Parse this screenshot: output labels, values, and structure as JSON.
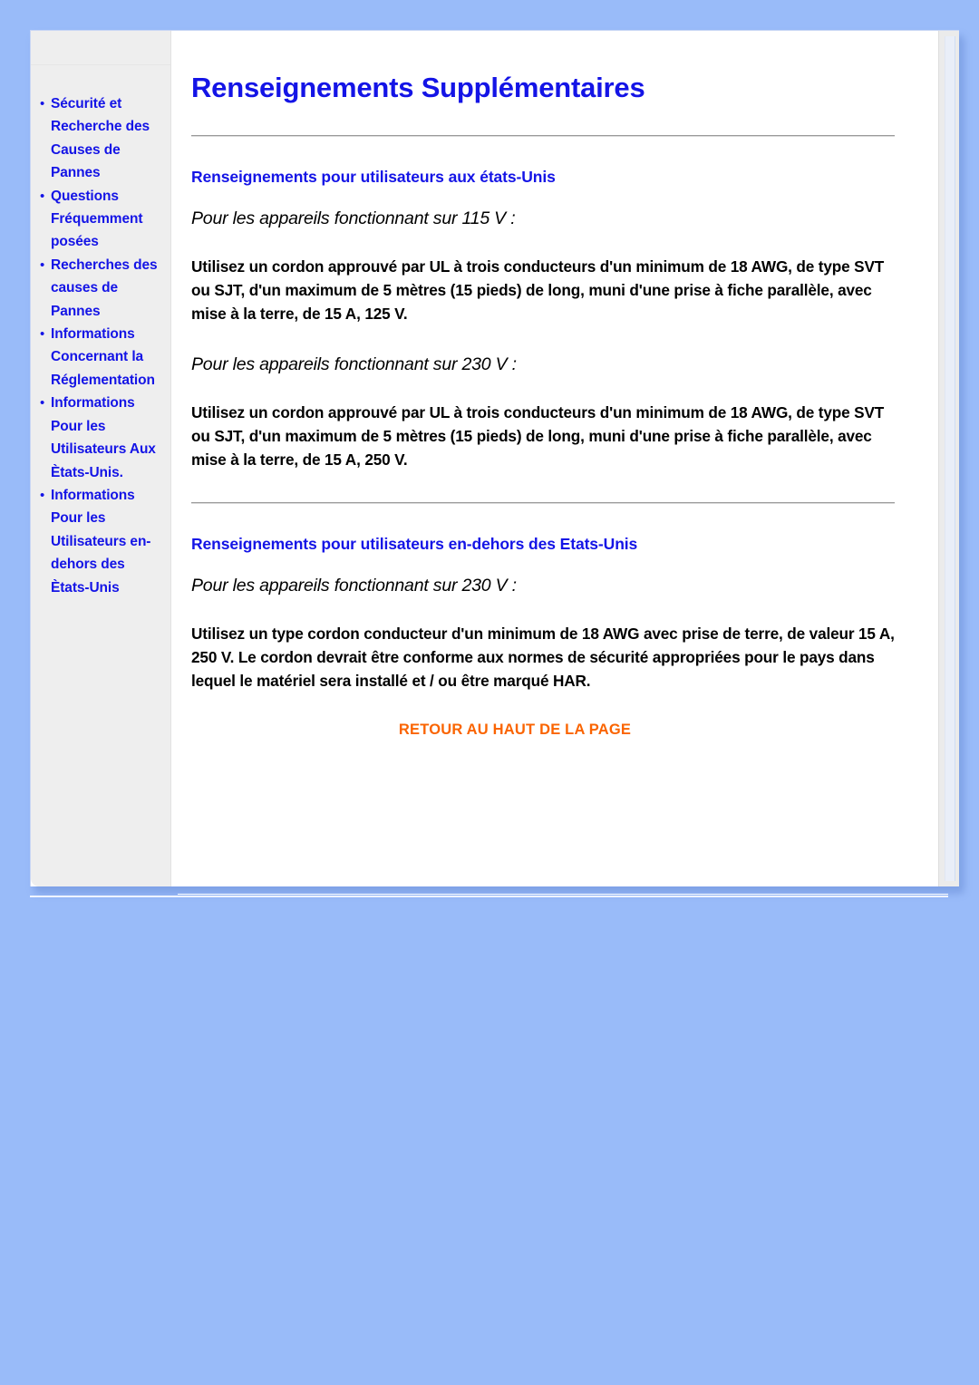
{
  "page": {
    "title": "Renseignements Supplémentaires",
    "background_color": "#99bbf9",
    "link_color": "#1414e6",
    "accent_color": "#fa6400"
  },
  "sidebar": {
    "items": [
      {
        "label": "Sécurité et Recherche des Causes de Pannes"
      },
      {
        "label": "Questions Fréquemment posées"
      },
      {
        "label": "Recherches des causes de Pannes"
      },
      {
        "label": "Informations Concernant la Réglementation"
      },
      {
        "label": "Informations Pour les Utilisateurs Aux Ètats-Unis."
      },
      {
        "label": "Informations Pour les Utilisateurs en-dehors des Ètats-Unis"
      }
    ],
    "bullet_glyph": "•"
  },
  "main": {
    "heading": "Renseignements Supplémentaires",
    "sections": [
      {
        "title": "Renseignements pour utilisateurs aux états-Unis",
        "blocks": [
          {
            "lead": "Pour les appareils fonctionnant sur 115 V :",
            "body": "Utilisez un cordon approuvé par UL à trois conducteurs d'un minimum de 18 AWG, de type SVT ou SJT, d'un maximum de 5 mètres (15 pieds) de long, muni d'une prise à fiche parallèle, avec mise à la terre, de 15 A, 125 V."
          },
          {
            "lead": "Pour les appareils fonctionnant sur 230 V :",
            "body": "Utilisez un cordon approuvé par UL à trois conducteurs d'un minimum de 18 AWG, de type SVT ou SJT, d'un maximum de 5 mètres (15 pieds) de long, muni d'une prise à fiche parallèle, avec mise à la terre, de 15 A, 250 V."
          }
        ]
      },
      {
        "title": "Renseignements pour utilisateurs en-dehors des Etats-Unis",
        "blocks": [
          {
            "lead": "Pour les appareils fonctionnant sur 230 V :",
            "body": "Utilisez un type cordon conducteur d'un minimum de 18 AWG avec prise de terre, de valeur 15 A, 250 V. Le cordon devrait être conforme aux normes de sécurité appropriées pour le pays dans lequel le matériel sera installé et / ou être marqué HAR."
          }
        ]
      }
    ],
    "back_to_top_label": "RETOUR AU HAUT DE LA PAGE"
  }
}
